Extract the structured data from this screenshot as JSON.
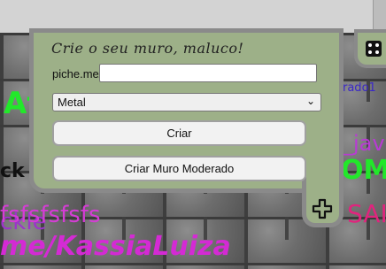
{
  "panel": {
    "title": "Crie o seu muro, maluco!",
    "url_prefix": "piche.me/",
    "url_value": "",
    "material_selected": "Metal",
    "create_button": "Criar",
    "moderated_button": "Criar Muro Moderado"
  },
  "graffiti": [
    {
      "text": "At",
      "color": "#22e82a"
    },
    {
      "text": "rado1",
      "color": "#3a27c8"
    },
    {
      "text": "ckle",
      "color": "#9b36c9"
    },
    {
      "text": "_java",
      "color": "#b93ad4"
    },
    {
      "text": "ck",
      "color": "#111111"
    },
    {
      "text": "OM",
      "color": "#22e82a"
    },
    {
      "text": "fsfsfsfsfs",
      "color": "#d63cd6"
    },
    {
      "text": "SAI",
      "color": "#e0247d"
    },
    {
      "text": "me/KassiaLuiza",
      "color": "#d42ad4"
    }
  ],
  "icons": {
    "add": "plus-icon",
    "random": "dice-icon",
    "dropdown": "chevron-down-icon"
  },
  "colors": {
    "panel": "#9db088",
    "border": "#8a8a8a"
  }
}
